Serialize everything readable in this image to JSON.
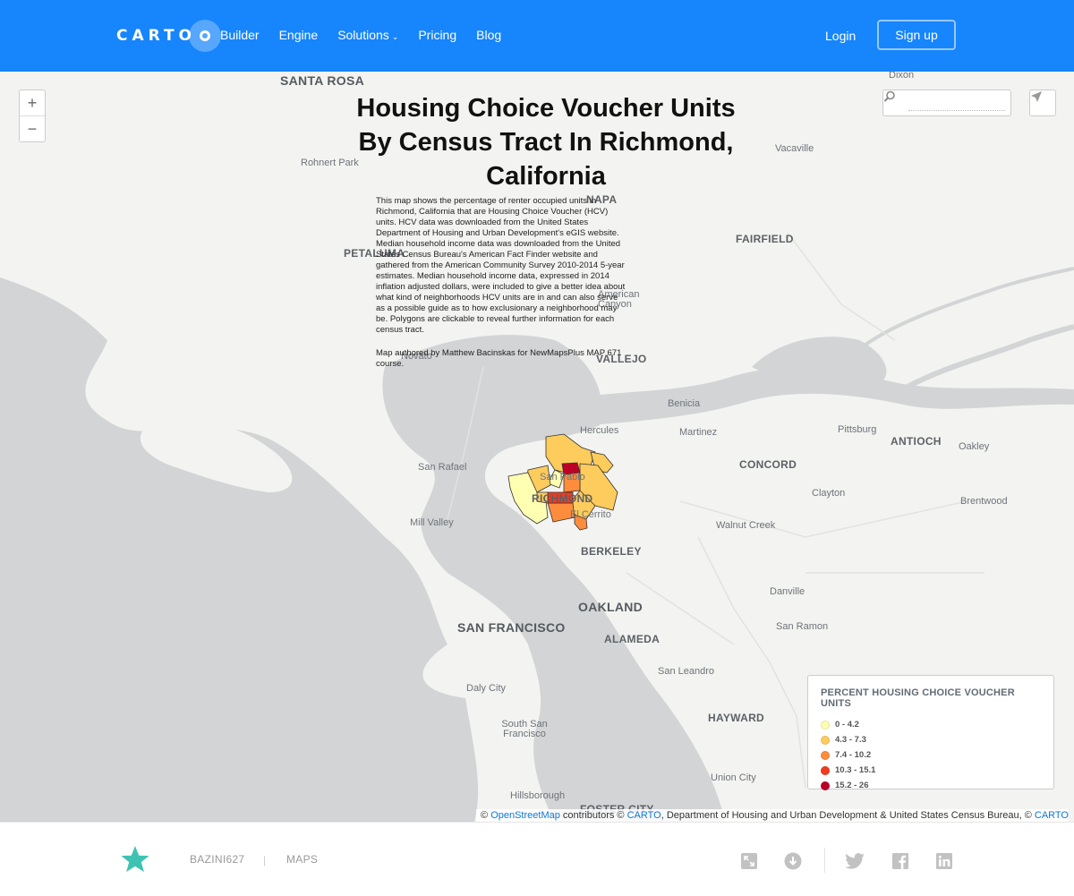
{
  "header": {
    "logo": "CARTO",
    "nav": [
      {
        "label": "Builder"
      },
      {
        "label": "Engine"
      },
      {
        "label": "Solutions",
        "dropdown": true
      },
      {
        "label": "Pricing"
      },
      {
        "label": "Blog"
      }
    ],
    "login_label": "Login",
    "signup_label": "Sign up",
    "colors": {
      "bar": "#1785fb"
    }
  },
  "map": {
    "title": "Housing Choice Voucher Units By Census Tract In Richmond, California",
    "description": "This map shows the percentage of renter occupied units in Richmond, California that are Housing Choice Voucher (HCV) units. HCV data was downloaded from the United States Department of Housing and Urban Development's eGIS website. Median household income data was downloaded from the United States Census Bureau's American Fact Finder website and gathered from the American Community Survey 2010-2014 5-year estimates. Median household income data, expressed in 2014 inflation adjusted dollars, were included to give a better idea about what kind of neighborhoods HCV units are in and can also serve as a possible guide as to how exclusionary a neighborhood may be. Polygons are clickable to reveal further information for each census tract.",
    "author": "Map authored by Matthew Bacinskas for NewMapsPlus MAP 671 course.",
    "zoom": {
      "in": "+",
      "out": "−"
    },
    "search": {
      "placeholder": ""
    },
    "place_labels": {
      "santa_rosa": "SANTA ROSA",
      "dixon": "Dixon",
      "rohnert_park": "Rohnert Park",
      "napa": "NAPA",
      "vacaville": "Vacaville",
      "fairfield": "FAIRFIELD",
      "petaluma": "PETALUMA",
      "american_canyon": "American Canyon",
      "novato": "Novato",
      "vallejo": "VALLEJO",
      "benicia": "Benicia",
      "hercules": "Hercules",
      "martinez": "Martinez",
      "pittsburg": "Pittsburg",
      "antioch": "ANTIOCH",
      "oakley": "Oakley",
      "san_rafael": "San Rafael",
      "san_pablo": "San Pablo",
      "concord": "CONCORD",
      "richmond": "RICHMOND",
      "clayton": "Clayton",
      "brentwood": "Brentwood",
      "el_cerrito": "El Cerrito",
      "mill_valley": "Mill Valley",
      "walnut_creek": "Walnut Creek",
      "berkeley": "BERKELEY",
      "danville": "Danville",
      "oakland": "OAKLAND",
      "san_francisco": "SAN FRANCISCO",
      "alameda": "ALAMEDA",
      "san_ramon": "San Ramon",
      "san_leandro": "San Leandro",
      "daly_city": "Daly City",
      "hayward": "HAYWARD",
      "south_san_francisco": "South San Francisco",
      "union_city": "Union City",
      "hillsborough": "Hillsborough",
      "foster_city": "FOSTER CITY"
    },
    "legend": {
      "title": "PERCENT HOUSING CHOICE VOUCHER UNITS",
      "items": [
        {
          "label": "0 - 4.2",
          "color": "#ffffb2"
        },
        {
          "label": "4.3 - 7.3",
          "color": "#fecc5c"
        },
        {
          "label": "7.4 - 10.2",
          "color": "#fd8d3c"
        },
        {
          "label": "10.3 - 15.1",
          "color": "#f03b20"
        },
        {
          "label": "15.2 - 26",
          "color": "#bd0026"
        }
      ]
    },
    "attribution": {
      "prefix": "©",
      "osm": "OpenStreetMap",
      "mid1": "contributors ©",
      "carto1": "CARTO",
      "mid2": ", Department of Housing and Urban Development & United States Census Bureau, ©",
      "carto2": "CARTO"
    }
  },
  "footer": {
    "username": "BAZINI627",
    "separator": "|",
    "section": "MAPS",
    "icons": [
      "star-icon",
      "fullscreen-icon",
      "download-icon",
      "twitter-icon",
      "facebook-icon",
      "linkedin-icon"
    ],
    "colors": {
      "star": "#3ec3b3"
    }
  }
}
